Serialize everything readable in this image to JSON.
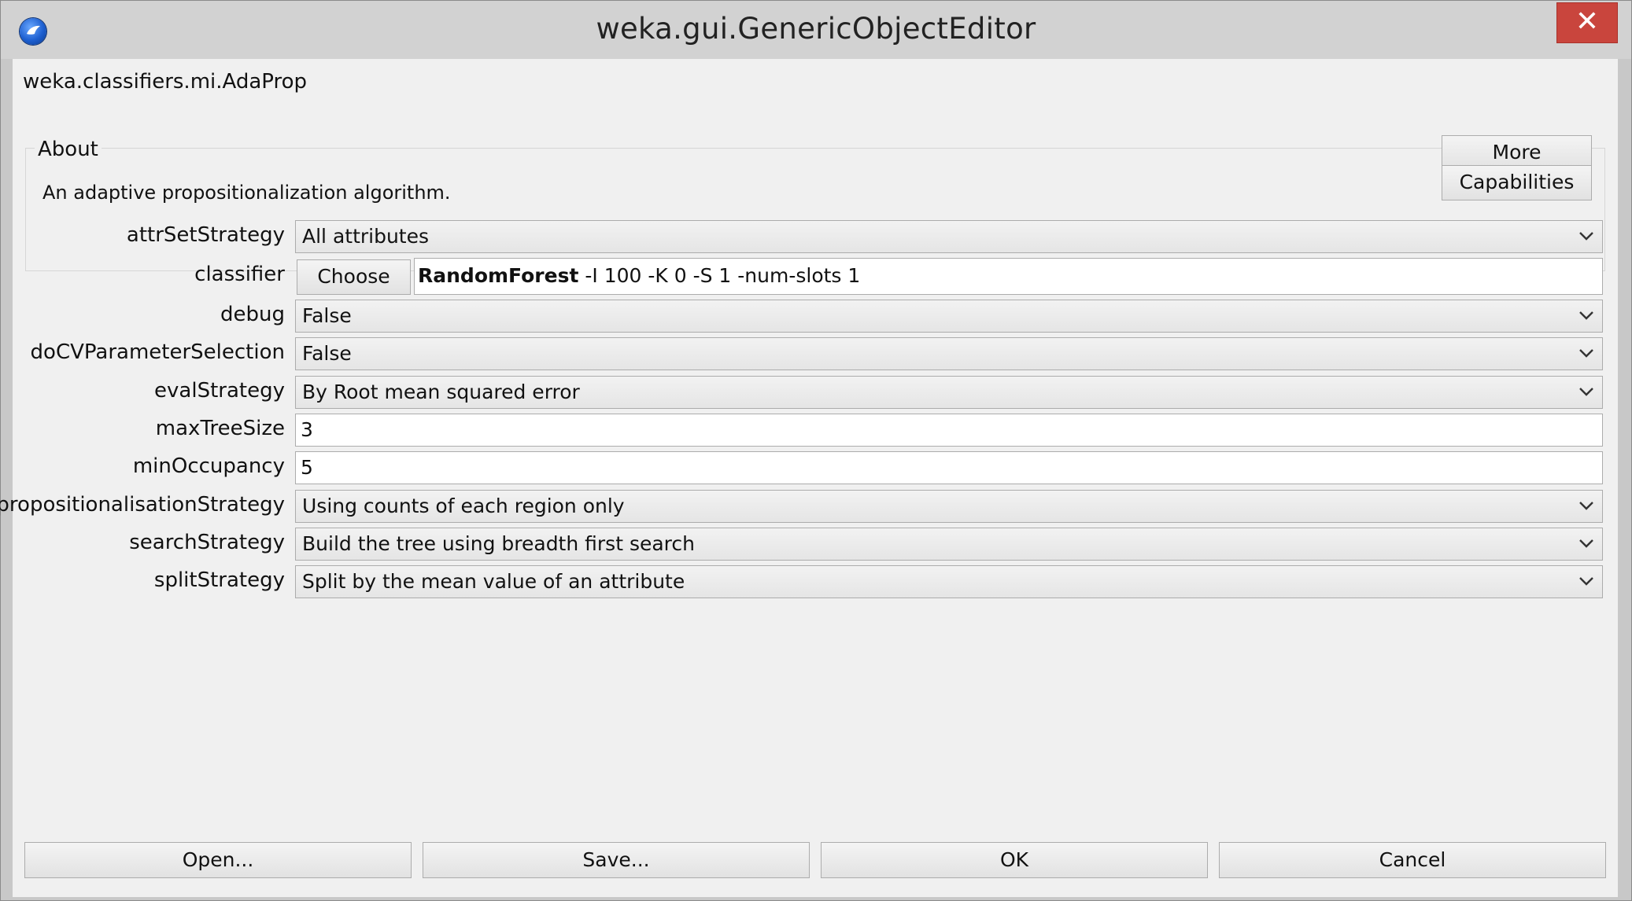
{
  "window": {
    "title": "weka.gui.GenericObjectEditor",
    "close_label": "✕"
  },
  "editor": {
    "class_name": "weka.classifiers.mi.AdaProp"
  },
  "about": {
    "legend": "About",
    "description": "An adaptive propositionalization algorithm.",
    "more_label": "More",
    "capabilities_label": "Capabilities"
  },
  "properties": {
    "attrSetStrategy": {
      "label": "attrSetStrategy",
      "value": "All attributes"
    },
    "classifier": {
      "label": "classifier",
      "choose_label": "Choose",
      "class_name": "RandomForest",
      "options": " -I 100 -K 0 -S 1 -num-slots 1"
    },
    "debug": {
      "label": "debug",
      "value": "False"
    },
    "doCVParameterSelection": {
      "label": "doCVParameterSelection",
      "value": "False"
    },
    "evalStrategy": {
      "label": "evalStrategy",
      "value": "By Root mean squared error"
    },
    "maxTreeSize": {
      "label": "maxTreeSize",
      "value": "3"
    },
    "minOccupancy": {
      "label": "minOccupancy",
      "value": "5"
    },
    "propositionalisationStrategy": {
      "label": "propositionalisationStrategy",
      "value": "Using counts of each region only"
    },
    "searchStrategy": {
      "label": "searchStrategy",
      "value": "Build the tree using breadth first search"
    },
    "splitStrategy": {
      "label": "splitStrategy",
      "value": "Split by the mean value of an attribute"
    }
  },
  "buttons": {
    "open": "Open...",
    "save": "Save...",
    "ok": "OK",
    "cancel": "Cancel"
  },
  "colors": {
    "close_button": "#c9453d",
    "window_background": "#f0f0f0"
  },
  "icons": {
    "app": "weka-bird-icon",
    "dropdown": "chevron-down-icon"
  }
}
